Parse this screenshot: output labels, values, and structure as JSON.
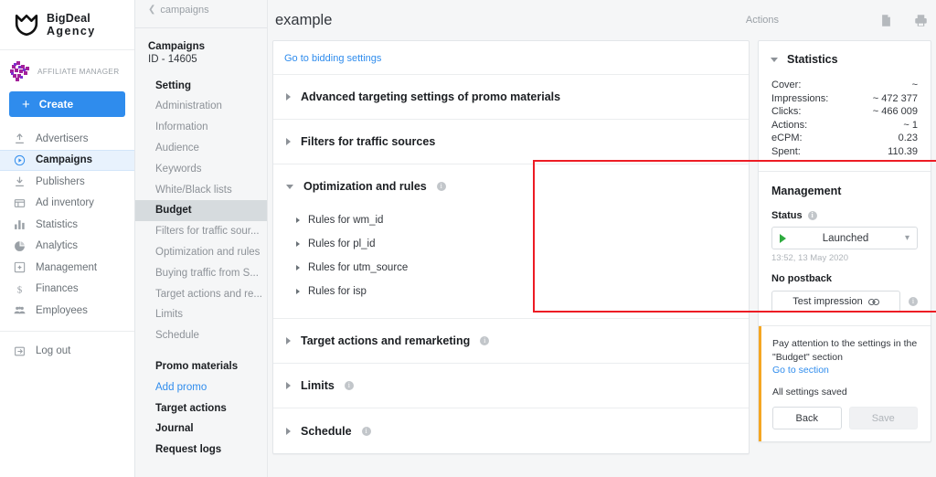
{
  "brand": {
    "line1": "BigDeal",
    "line2": "Agency",
    "logo_icon": "shield-logo-icon"
  },
  "user": {
    "role": "AFFILIATE MANAGER",
    "avatar_icon": "user-avatar-icon"
  },
  "create_button": {
    "label": "Create",
    "plus": "+"
  },
  "nav_primary": {
    "items": [
      {
        "label": "Advertisers",
        "icon": "upload-arrow-icon",
        "active": false
      },
      {
        "label": "Campaigns",
        "icon": "play-circle-icon",
        "active": true
      },
      {
        "label": "Publishers",
        "icon": "download-arrow-icon",
        "active": false
      },
      {
        "label": "Ad inventory",
        "icon": "window-layout-icon",
        "active": false
      },
      {
        "label": "Statistics",
        "icon": "bar-chart-icon",
        "active": false
      },
      {
        "label": "Analytics",
        "icon": "pie-chart-icon",
        "active": false
      },
      {
        "label": "Management",
        "icon": "settings-square-icon",
        "active": false
      },
      {
        "label": "Finances",
        "icon": "dollar-sign-icon",
        "active": false
      },
      {
        "label": "Employees",
        "icon": "people-icon",
        "active": false
      }
    ],
    "logout": {
      "label": "Log out",
      "icon": "logout-icon"
    }
  },
  "nav_secondary": {
    "back_label": "campaigns",
    "back_icon": "chevron-left-icon",
    "campaign_title": "Campaigns",
    "campaign_id": "ID - 14605",
    "group_title": "Setting",
    "items": [
      {
        "label": "Administration",
        "style": "muted"
      },
      {
        "label": "Information",
        "style": "muted"
      },
      {
        "label": "Audience",
        "style": "muted"
      },
      {
        "label": "Keywords",
        "style": "muted"
      },
      {
        "label": "White/Black lists",
        "style": "muted"
      },
      {
        "label": "Budget",
        "style": "selected"
      },
      {
        "label": "Filters for traffic sour...",
        "style": "muted"
      },
      {
        "label": "Optimization and rules",
        "style": "muted"
      },
      {
        "label": "Buying traffic from S...",
        "style": "muted"
      },
      {
        "label": "Target actions and re...",
        "style": "muted"
      },
      {
        "label": "Limits",
        "style": "muted"
      },
      {
        "label": "Schedule",
        "style": "muted"
      }
    ],
    "items_tail": [
      {
        "label": "Promo materials",
        "style": "bold"
      },
      {
        "label": "Add promo",
        "style": "link"
      },
      {
        "label": "Target actions",
        "style": "bold"
      },
      {
        "label": "Journal",
        "style": "bold"
      },
      {
        "label": "Request logs",
        "style": "bold"
      }
    ]
  },
  "topbar": {
    "title": "example",
    "actions_label": "Actions",
    "doc_icon": "document-icon",
    "print_icon": "printer-icon"
  },
  "main_panel": {
    "bidding_link": "Go to bidding settings",
    "sections": [
      {
        "label": "Advanced targeting settings of promo materials",
        "expanded": false,
        "info": false
      },
      {
        "label": "Filters for traffic sources",
        "expanded": false,
        "info": false
      }
    ],
    "optimization": {
      "label": "Optimization and rules",
      "expanded": true,
      "info": true,
      "rules": [
        "Rules for wm_id",
        "Rules for pl_id",
        "Rules for utm_source",
        "Rules for isp"
      ]
    },
    "sections_tail": [
      {
        "label": "Target actions and remarketing",
        "expanded": false,
        "info": true
      },
      {
        "label": "Limits",
        "expanded": false,
        "info": true
      },
      {
        "label": "Schedule",
        "expanded": false,
        "info": true
      }
    ]
  },
  "statistics": {
    "title": "Statistics",
    "rows": [
      {
        "label": "Cover:",
        "value": "~"
      },
      {
        "label": "Impressions:",
        "value": "~ 472 377"
      },
      {
        "label": "Clicks:",
        "value": "~ 466 009"
      },
      {
        "label": "Actions:",
        "value": "~ 1"
      },
      {
        "label": "eCPM:",
        "value": "0.23"
      },
      {
        "label": "Spent:",
        "value": "110.39"
      }
    ]
  },
  "management": {
    "title": "Management",
    "status_label": "Status",
    "status_value": "Launched",
    "status_time": "13:52, 13 May 2020",
    "no_postback": "No postback",
    "test_button": "Test impression",
    "test_icon": "link-chain-icon"
  },
  "notice": {
    "text": "Pay attention to the settings in the \"Budget\" section",
    "link": "Go to section",
    "saved": "All settings saved",
    "back_button": "Back",
    "save_button": "Save"
  },
  "colors": {
    "accent_blue": "#2f8ced",
    "highlight_red": "#ed1c24",
    "notice_orange": "#f5a623",
    "status_green": "#2fab3f"
  }
}
